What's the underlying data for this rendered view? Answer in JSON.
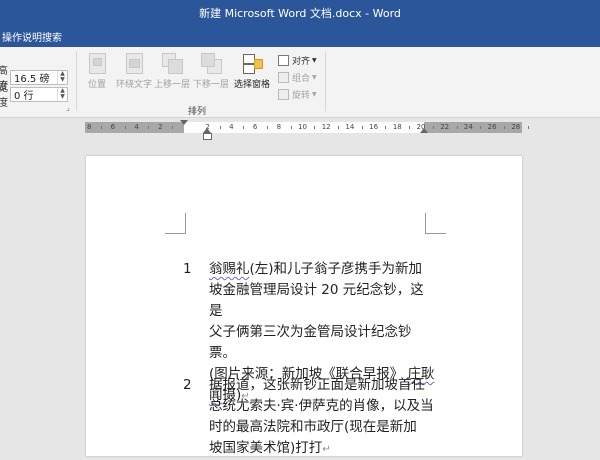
{
  "window": {
    "title": "新建 Microsoft Word 文档.docx  -  Word"
  },
  "tell_me": {
    "text": "操作说明搜索"
  },
  "ribbon": {
    "size": [
      {
        "label": "高度",
        "value": "16.5 磅"
      },
      {
        "label": "宽度",
        "value": "0 行"
      }
    ],
    "buttons": {
      "position": "位置",
      "wrap_text": "环绕文字",
      "bring_forward": "上移一层",
      "send_backward": "下移一层",
      "selection_pane": "选择窗格"
    },
    "small_buttons": {
      "align": "对齐",
      "group": "组合",
      "rotate": "旋转"
    },
    "group_label": "排列"
  },
  "ruler": {
    "numbers": [
      "8",
      "6",
      "4",
      "2",
      "2",
      "4",
      "6",
      "8",
      "10",
      "12",
      "14",
      "16",
      "18",
      "20",
      "22",
      "24",
      "26",
      "28"
    ]
  },
  "document": {
    "items": [
      {
        "number": "1",
        "lines": [
          {
            "underlined": "翁赐礼",
            "rest": "(左)和儿子翁子彦携手为新加"
          },
          {
            "text": "坡金融管理局设计 20 元纪念钞，这是"
          },
          {
            "text": "父子俩第三次为金管局设计纪念钞票。"
          },
          {
            "text": "(图片来源：新加坡《联合早报》 ",
            "underlined": "庄耿"
          },
          {
            "underlined": "闻",
            "rest": "摄)",
            "mark": "↵"
          }
        ]
      },
      {
        "number": "2",
        "lines": [
          {
            "text": "据报道，这张新钞正面是新加坡首任"
          },
          {
            "text": "总统尤索夫·宾·伊萨克的肖像，以及当"
          },
          {
            "text": "时的最高法院和市政厅(现在是新加"
          },
          {
            "text": "坡国家美术馆)打打",
            "mark": "↵"
          }
        ]
      }
    ]
  }
}
